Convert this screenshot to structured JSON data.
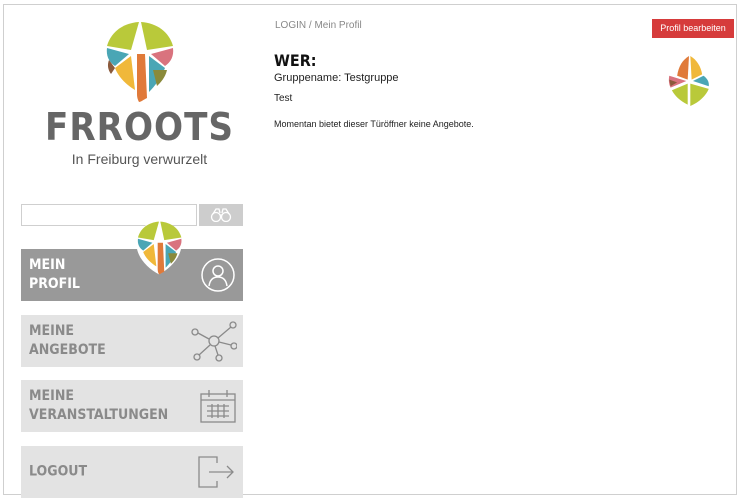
{
  "brand": {
    "name": "FRROOTS",
    "tagline": "In Freiburg verwurzelt",
    "colors": {
      "green": "#b9c93a",
      "teal": "#4aa6b5",
      "orange": "#e07a3a",
      "pink": "#d9737e",
      "olive": "#8a8a3a",
      "yellow": "#f0b83a",
      "brown": "#8b5a3c"
    }
  },
  "search": {
    "placeholder": "",
    "icon": "binoculars-icon"
  },
  "nav": {
    "items": [
      {
        "line1": "MEIN",
        "line2": "PROFIL",
        "icon": "user-circle-icon",
        "active": true
      },
      {
        "line1": "MEINE",
        "line2": "ANGEBOTE",
        "icon": "network-icon",
        "active": false
      },
      {
        "line1": "MEINE",
        "line2": "VERANSTALTUNGEN",
        "icon": "calendar-icon",
        "active": false
      },
      {
        "line1": "LOGOUT",
        "line2": "",
        "icon": "logout-icon",
        "active": false
      }
    ]
  },
  "main": {
    "breadcrumb": "LOGIN / Mein Profil",
    "edit_button": "Profil bearbeiten",
    "section_title": "WER:",
    "group_name": "Gruppename: Testgruppe",
    "description": "Test",
    "info": "Momentan bietet dieser Türöffner keine Angebote."
  }
}
